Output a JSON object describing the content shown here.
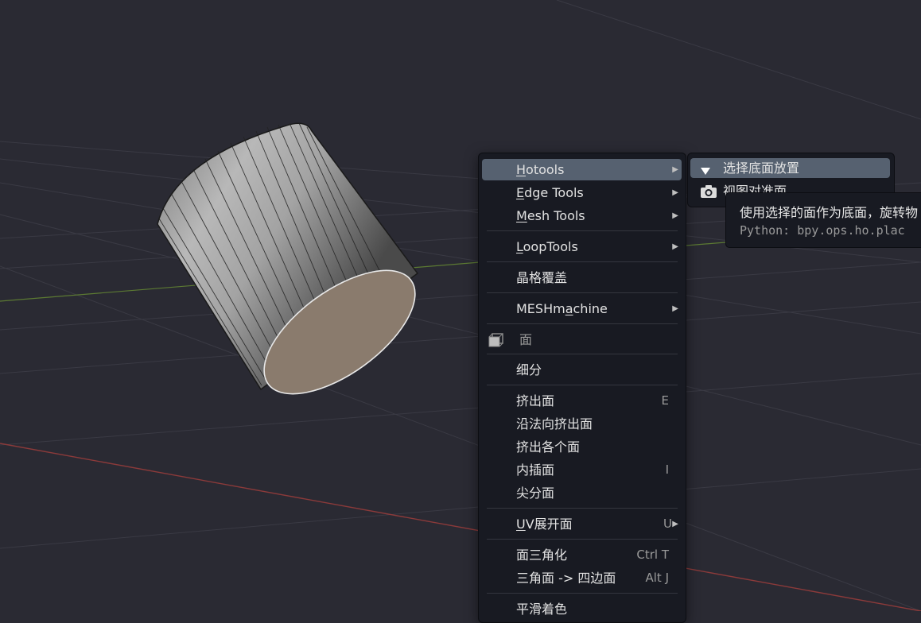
{
  "viewport": {
    "background": "#2a2a33",
    "object": "cylinder",
    "colors": {
      "x_axis": "#8b3a3a",
      "y_axis": "#5c7a33",
      "grid": "#3a3a44",
      "cap": "#8a7b6d"
    }
  },
  "menu": {
    "items": [
      {
        "label_pre": "",
        "label_u": "H",
        "label_post": "otools",
        "shortcut": "",
        "arrow": "▶"
      },
      {
        "label_pre": "",
        "label_u": "E",
        "label_post": "dge Tools",
        "shortcut": "",
        "arrow": "▶"
      },
      {
        "label_pre": "",
        "label_u": "M",
        "label_post": "esh Tools",
        "shortcut": "",
        "arrow": "▶"
      },
      {
        "label_pre": "",
        "label_u": "L",
        "label_post": "oopTools",
        "shortcut": "",
        "arrow": "▶"
      },
      {
        "label_pre": "晶格覆盖",
        "label_u": "",
        "label_post": "",
        "shortcut": "",
        "arrow": ""
      },
      {
        "label_pre": "MESHm",
        "label_u": "a",
        "label_post": "chine",
        "shortcut": "",
        "arrow": "▶"
      },
      {
        "label_pre": "细分",
        "label_u": "",
        "label_post": "",
        "shortcut": "",
        "arrow": ""
      },
      {
        "label_pre": "挤出面",
        "label_u": "",
        "label_post": "",
        "shortcut": "E",
        "arrow": ""
      },
      {
        "label_pre": "沿法向挤出面",
        "label_u": "",
        "label_post": "",
        "shortcut": "",
        "arrow": ""
      },
      {
        "label_pre": "挤出各个面",
        "label_u": "",
        "label_post": "",
        "shortcut": "",
        "arrow": ""
      },
      {
        "label_pre": "内插面",
        "label_u": "",
        "label_post": "",
        "shortcut": "I",
        "arrow": ""
      },
      {
        "label_pre": "尖分面",
        "label_u": "",
        "label_post": "",
        "shortcut": "",
        "arrow": ""
      },
      {
        "label_pre": "",
        "label_u": "U",
        "label_post": "V展开面",
        "shortcut": "U",
        "arrow": "▶"
      },
      {
        "label_pre": "面三角化",
        "label_u": "",
        "label_post": "",
        "shortcut": "Ctrl T",
        "arrow": ""
      },
      {
        "label_pre": "三角面 -> 四边面",
        "label_u": "",
        "label_post": "",
        "shortcut": "Alt J",
        "arrow": ""
      },
      {
        "label_pre": "平滑着色",
        "label_u": "",
        "label_post": "",
        "shortcut": "",
        "arrow": ""
      }
    ],
    "section_header": {
      "label": "面",
      "icon": "face-select-icon"
    }
  },
  "submenu": {
    "items": [
      {
        "label": "选择底面放置",
        "icon": "triangle-down-icon"
      },
      {
        "label": "视图对准面",
        "icon": "camera-icon"
      }
    ]
  },
  "tooltip": {
    "description": "使用选择的面作为底面，旋转物",
    "python": "Python: bpy.ops.ho.plac"
  }
}
